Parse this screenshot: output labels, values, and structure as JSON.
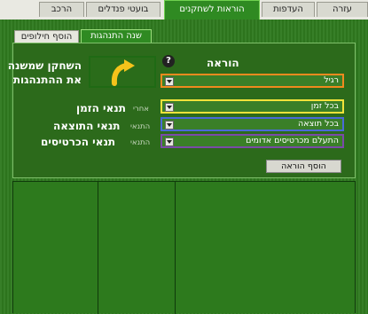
{
  "top_tabs": [
    {
      "label": "עזרה"
    },
    {
      "label": "העדפות"
    },
    {
      "label": "הוראות לשחקנים"
    },
    {
      "label": "בועטי פנדלים"
    },
    {
      "label": "הרכב"
    }
  ],
  "sub_tabs": [
    {
      "label": "שנה התנהגות"
    },
    {
      "label": "הוסף חילופים"
    }
  ],
  "instruction": {
    "heading": "הוראה",
    "value": "רגיל",
    "player_change_label": "השחקן שמשנה את ההתנהגות"
  },
  "conditions": {
    "time": {
      "prefix": "אחרי",
      "label": "תנאי הזמן",
      "value": "בכל זמן"
    },
    "result": {
      "prefix": "התנאי",
      "label": "תנאי התוצאה",
      "value": "בכל תוצאה"
    },
    "cards": {
      "prefix": "התנאי",
      "label": "תנאי הכרטיסים",
      "value": "התעלם מכרטיסים אדומים"
    }
  },
  "add_instruction_button": "הוסף הוראה",
  "colors": {
    "orange": "#f08a1e",
    "yellow": "#f2e23a",
    "blue": "#4a6ad8",
    "purple": "#7a4aa8",
    "green_dark": "#2c6a1b"
  },
  "icons": {
    "help": "question-circle-icon",
    "curved_arrow": "curved-arrow-icon"
  }
}
